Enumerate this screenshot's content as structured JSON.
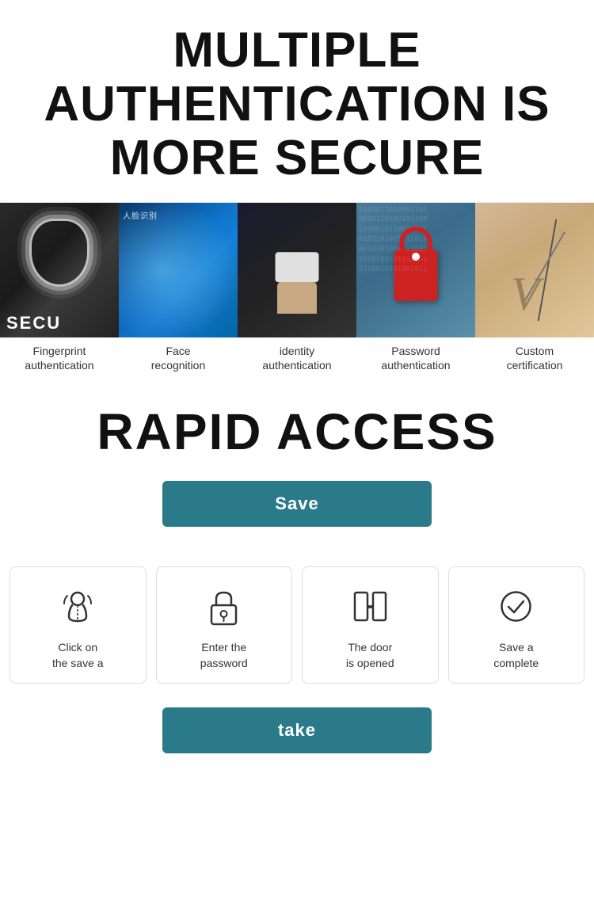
{
  "header": {
    "title": "MULTIPLE AUTHENTICATION IS MORE SECURE"
  },
  "auth_types": [
    {
      "id": "fingerprint",
      "label_line1": "Fingerprint",
      "label_line2": "authentication",
      "image_type": "fingerprint"
    },
    {
      "id": "face",
      "label_line1": "Face",
      "label_line2": "recognition",
      "image_type": "face"
    },
    {
      "id": "identity",
      "label_line1": "identity",
      "label_line2": "authentication",
      "image_type": "identity"
    },
    {
      "id": "password",
      "label_line1": "Password",
      "label_line2": "authentication",
      "image_type": "password"
    },
    {
      "id": "custom",
      "label_line1": "Custom",
      "label_line2": "certification",
      "image_type": "custom"
    }
  ],
  "rapid_access": {
    "title": "RAPID ACCESS",
    "save_button_label": "Save",
    "take_button_label": "take"
  },
  "steps": [
    {
      "id": "click-save",
      "icon": "touch",
      "label_line1": "Click on",
      "label_line2": "the save a"
    },
    {
      "id": "enter-password",
      "icon": "lock",
      "label_line1": "Enter the",
      "label_line2": "password"
    },
    {
      "id": "door-opened",
      "icon": "door",
      "label_line1": "The door",
      "label_line2": "is opened"
    },
    {
      "id": "save-complete",
      "icon": "checkmark",
      "label_line1": "Save a",
      "label_line2": "complete"
    }
  ],
  "binary_text": "0101011010001101\n0010110100101100\n1010010110010101\n0101101001011010\n0010101001101001\n1010100101100101\n0110010101001011"
}
